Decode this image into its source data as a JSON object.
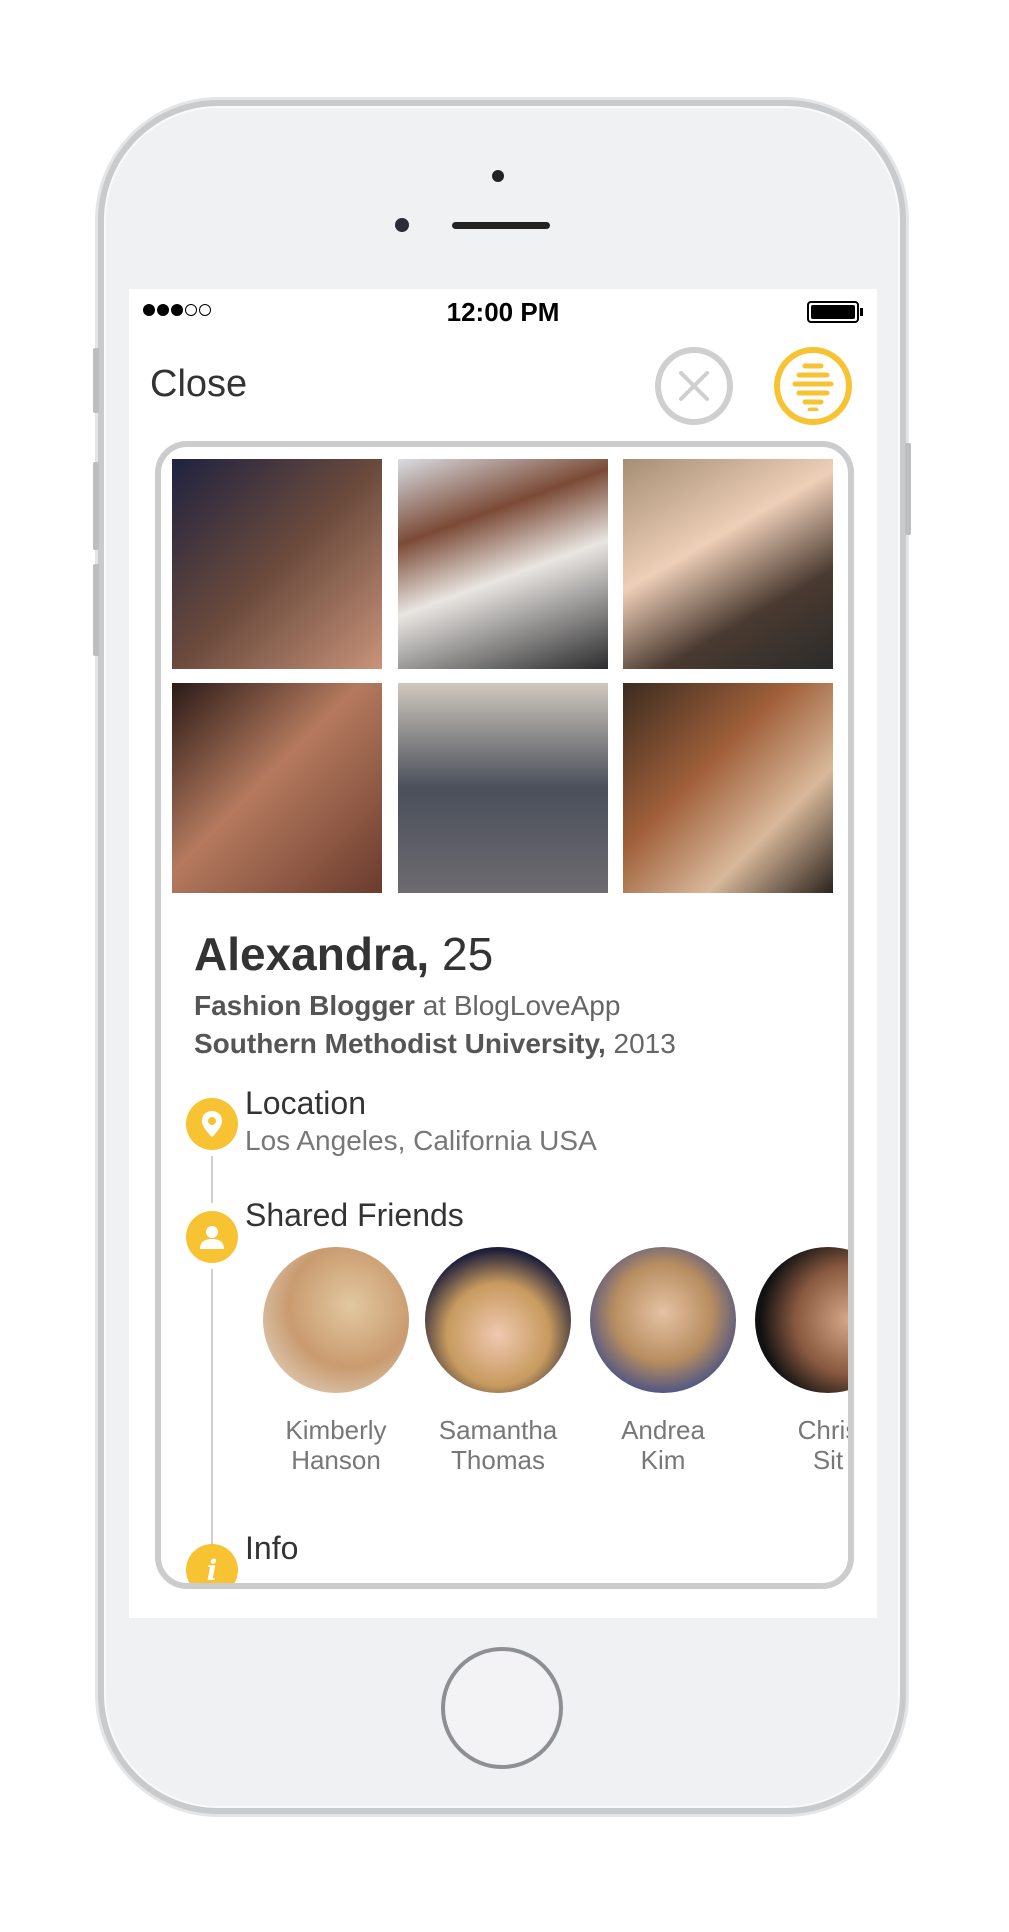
{
  "status_bar": {
    "signal_dots_filled": 3,
    "signal_dots_total": 5,
    "time": "12:00 PM",
    "battery_level": 1.0
  },
  "header": {
    "close_label": "Close",
    "dismiss_icon": "x-circle-icon",
    "like_icon": "beehive-icon",
    "accent_color": "#f7c332"
  },
  "profile": {
    "name": "Alexandra,",
    "age": "25",
    "job_title": "Fashion Blogger",
    "job_connector": "at",
    "company": "BlogLoveApp",
    "school": "Southern Methodist University,",
    "school_year": "2013",
    "photos": 6
  },
  "sections": {
    "location": {
      "title": "Location",
      "value": "Los Angeles, California USA",
      "icon": "map-pin-icon"
    },
    "friends": {
      "title": "Shared Friends",
      "icon": "user-icon",
      "items": [
        {
          "first": "Kimberly",
          "last": "Hanson"
        },
        {
          "first": "Samantha",
          "last": "Thomas"
        },
        {
          "first": "Andrea",
          "last": "Kim"
        },
        {
          "first": "Chris",
          "last": "Sit"
        }
      ]
    },
    "info": {
      "title": "Info",
      "icon": "info-icon"
    }
  }
}
